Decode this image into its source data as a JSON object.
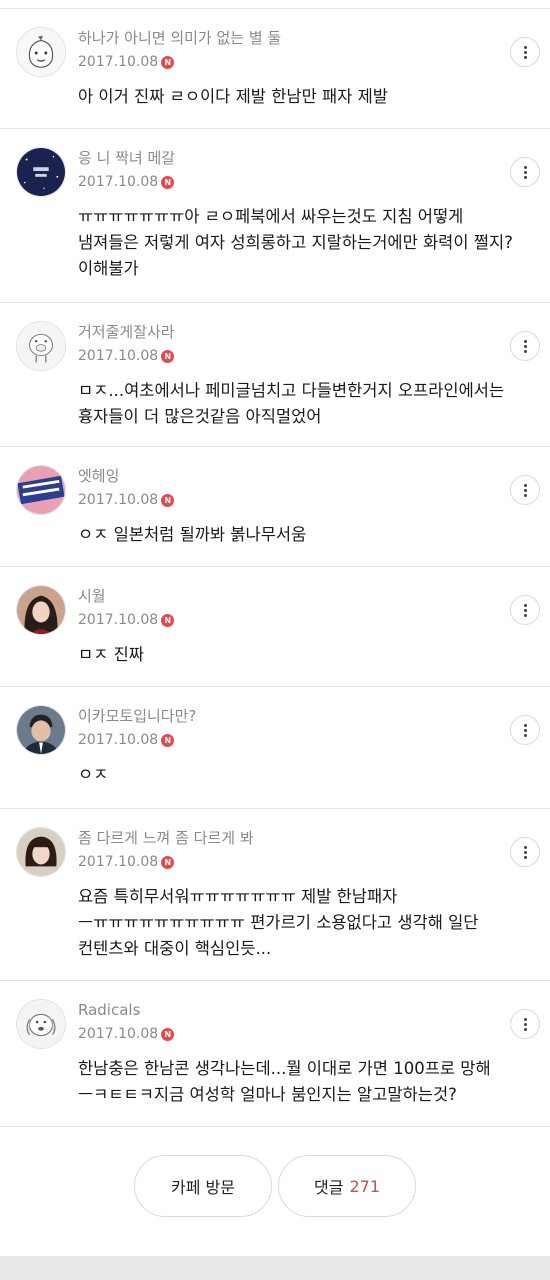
{
  "comments": [
    {
      "nickname": "하나가 아니면 의미가 없는 별 둘",
      "date": "2017.10.08",
      "badge": "N",
      "text": "아 이거 진짜 ㄹㅇ이다 제발 한남만 패자 제발",
      "avatar_icon": "cartoon-face-icon"
    },
    {
      "nickname": "응 니 짝녀 메갈",
      "date": "2017.10.08",
      "badge": "N",
      "text": "ㅠㅠㅠㅠㅠㅠㅠ아 ㄹㅇ페북에서 싸우는것도 지침 어떻게 냄져들은 저렇게 여자 성희롱하고 지랄하는거에만 화력이 쩔지? 이해불가",
      "avatar_icon": "night-sky-icon"
    },
    {
      "nickname": "거저줄게잘사라",
      "date": "2017.10.08",
      "badge": "N",
      "text": "ㅁㅈ...여초에서나 페미글넘치고 다들변한거지 오프라인에서는 흉자들이 더 많은것같음 아직멀었어",
      "avatar_icon": "pig-icon"
    },
    {
      "nickname": "엣헤잉",
      "date": "2017.10.08",
      "badge": "N",
      "text": "ㅇㅈ 일본처럼 될까봐 볽나무서움",
      "avatar_icon": "proud-feminist-badge-icon"
    },
    {
      "nickname": "시월",
      "date": "2017.10.08",
      "badge": "N",
      "text": "ㅁㅈ 진짜",
      "avatar_icon": "woman-portrait-icon"
    },
    {
      "nickname": "이카모토입니다만?",
      "date": "2017.10.08",
      "badge": "N",
      "text": "ㅇㅈ",
      "avatar_icon": "man-portrait-icon"
    },
    {
      "nickname": "좀 다르게 느껴 좀 다르게 봐",
      "date": "2017.10.08",
      "badge": "N",
      "text": "요즘 특히무서워ㅠㅠㅠㅠㅠㅠㅠ 제발 한남패자 ㅡㅠㅠㅠㅠㅠㅠㅠㅠㅠㅠ 편가르기 소용없다고 생각해 일단 컨텐츠와 대중이 핵심인듯...",
      "avatar_icon": "woman-portrait-icon"
    },
    {
      "nickname": "Radicals",
      "date": "2017.10.08",
      "badge": "N",
      "text": "한남충은 한남콘 생각나는데...뭘 이대로 가면 100프로 망해 ㅡㅋㅌㅌㅋ지금 여성학 얼마나 붐인지는 알고말하는것?",
      "avatar_icon": "dog-icon"
    }
  ],
  "footer": {
    "cafe_visit_label": "카페 방문",
    "comments_label": "댓글",
    "comments_count": "271",
    "count_color": "#d24a4a"
  },
  "colors": {
    "badge": "#e24b4b",
    "meta_text": "#8a8a8a"
  }
}
